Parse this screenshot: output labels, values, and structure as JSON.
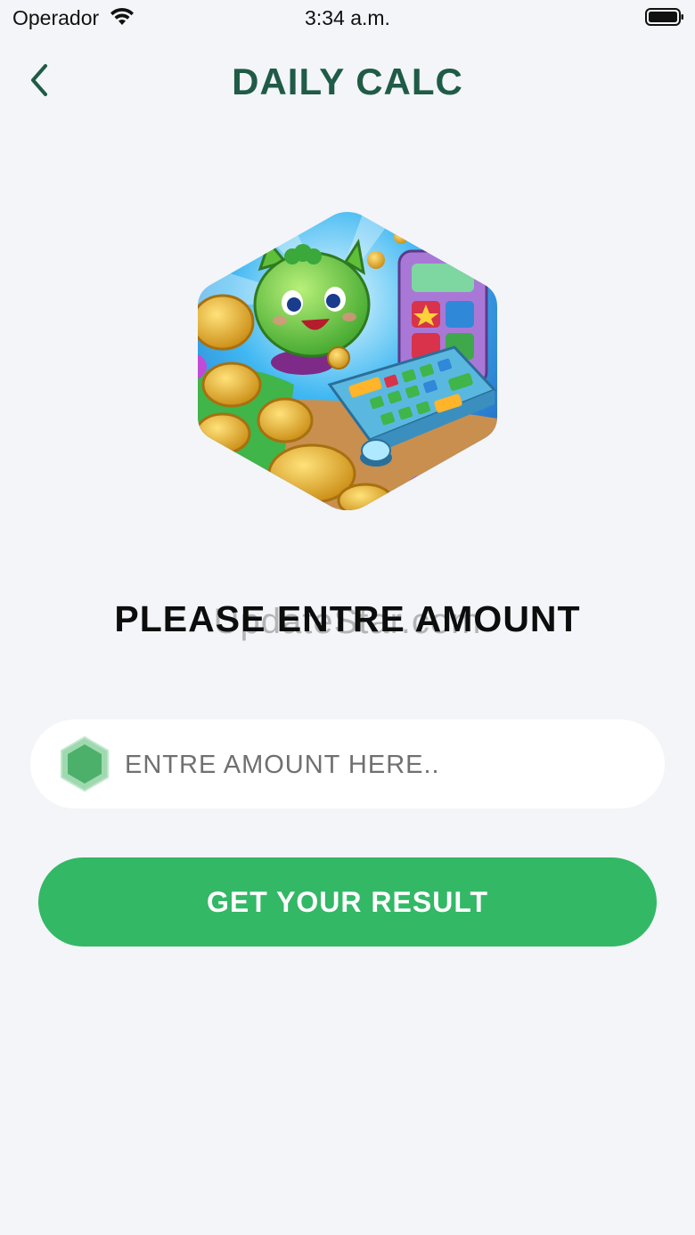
{
  "status_bar": {
    "carrier": "Operador",
    "time": "3:34 a.m.",
    "icons": [
      "wifi-icon",
      "battery-icon"
    ]
  },
  "nav": {
    "back_icon": "chevron-left-icon",
    "title": "DAILY CALC"
  },
  "hero": {
    "image": "hexagon-illustration-green-cat-calculator-coins"
  },
  "prompt": {
    "heading": "PLEASE ENTRE AMOUNT",
    "watermark": "UpdateStar.com"
  },
  "amount_input": {
    "icon": "green-hexagon-icon",
    "placeholder": "ENTRE AMOUNT HERE..",
    "value": ""
  },
  "result_button": {
    "label": "GET YOUR RESULT"
  },
  "colors": {
    "background": "#f3f5f8",
    "title": "#1f5b46",
    "accent": "#33b866",
    "input_bg": "#ffffff"
  }
}
